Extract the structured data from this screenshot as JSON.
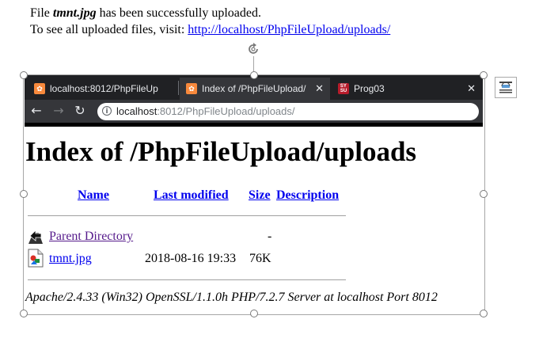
{
  "message": {
    "line1_prefix": "File",
    "file_name": "tmnt.jpg",
    "line1_suffix": "has been successfully uploaded.",
    "line2_text": "To see all uploaded files, visit:",
    "line2_link": "http://localhost/PhpFileUpload/uploads/"
  },
  "browser": {
    "tabs": [
      {
        "label": "localhost:8012/PhpFileUp",
        "favicon": "xampp-icon",
        "active": false
      },
      {
        "label": "Index of /PhpFileUpload/",
        "favicon": "xampp-icon",
        "active": true
      },
      {
        "label": "Prog03",
        "favicon": "sysu-icon",
        "active": false
      }
    ],
    "tab_close": "✕",
    "address_host": "localhost",
    "address_rest": ":8012/PhpFileUpload/uploads/"
  },
  "page": {
    "heading": "Index of /PhpFileUpload/uploads",
    "columns": [
      "Name",
      "Last modified",
      "Size",
      "Description"
    ],
    "rows": [
      {
        "name": "Parent Directory",
        "modified": "",
        "size": "-",
        "description": "",
        "icon": "back-folder-icon"
      },
      {
        "name": "tmnt.jpg",
        "modified": "2018-08-16 19:33",
        "size": "76K",
        "description": "",
        "icon": "image-file-icon"
      }
    ],
    "address": "Apache/2.4.33 (Win32) OpenSSL/1.1.0h PHP/7.2.7 Server at localhost Port 8012"
  },
  "colors": {
    "link": "#0000ee",
    "visited_link": "#551a8b",
    "tab_bar": "#202124",
    "toolbar": "#35363a",
    "xampp_orange": "#f8893c"
  }
}
